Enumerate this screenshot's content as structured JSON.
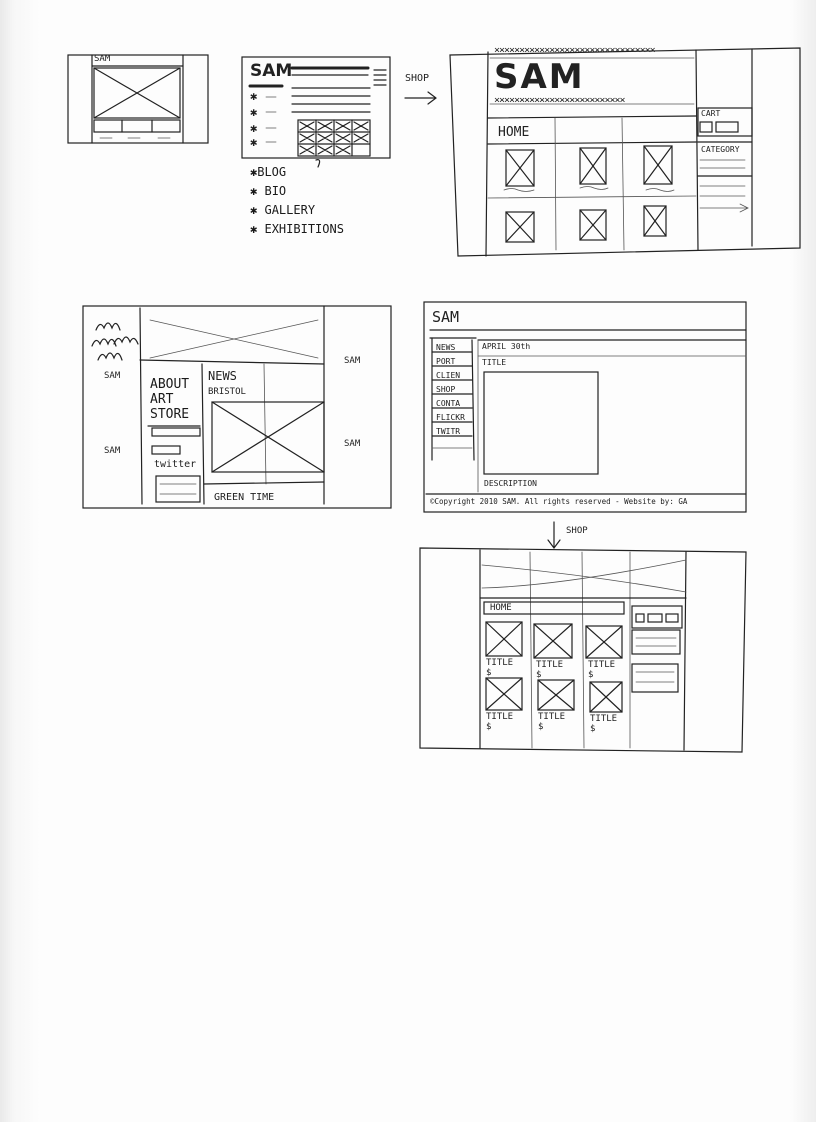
{
  "thumb1": {
    "logo": "SAM"
  },
  "sketch2": {
    "logo": "SAM",
    "nav": [
      "BLOG",
      "BIO",
      "GALLERY",
      "EXHIBITIONS"
    ],
    "nav_bullet": "✱",
    "arrow_label": "SHOP"
  },
  "shop_big": {
    "logo": "SAM",
    "tab": "HOME",
    "sidebar": [
      "CART",
      "CATEGORY"
    ]
  },
  "sketch3": {
    "logo": "SAM",
    "menu": [
      "ABOUT",
      "ART",
      "STORE"
    ],
    "widget_label": "twitter",
    "news_title": "NEWS",
    "news_sub": "BRISTOL",
    "footer": "GREEN TIME",
    "side_labels": [
      "SAM",
      "SAM",
      "SAM",
      "SAM"
    ]
  },
  "sketch4": {
    "logo": "SAM",
    "nav": [
      "NEWS",
      "PORT",
      "CLIEN",
      "SHOP",
      "CONTA",
      "FLICKR",
      "TWITR"
    ],
    "date": "APRIL 30th",
    "title": "TITLE",
    "description": "DESCRIPTION",
    "copyright": "©Copyright 2010 SAM. All rights reserved - Website by: GA",
    "arrow_label": "SHOP"
  },
  "sketch5": {
    "tab": "HOME",
    "product_title": "TITLE",
    "product_price": "$"
  }
}
